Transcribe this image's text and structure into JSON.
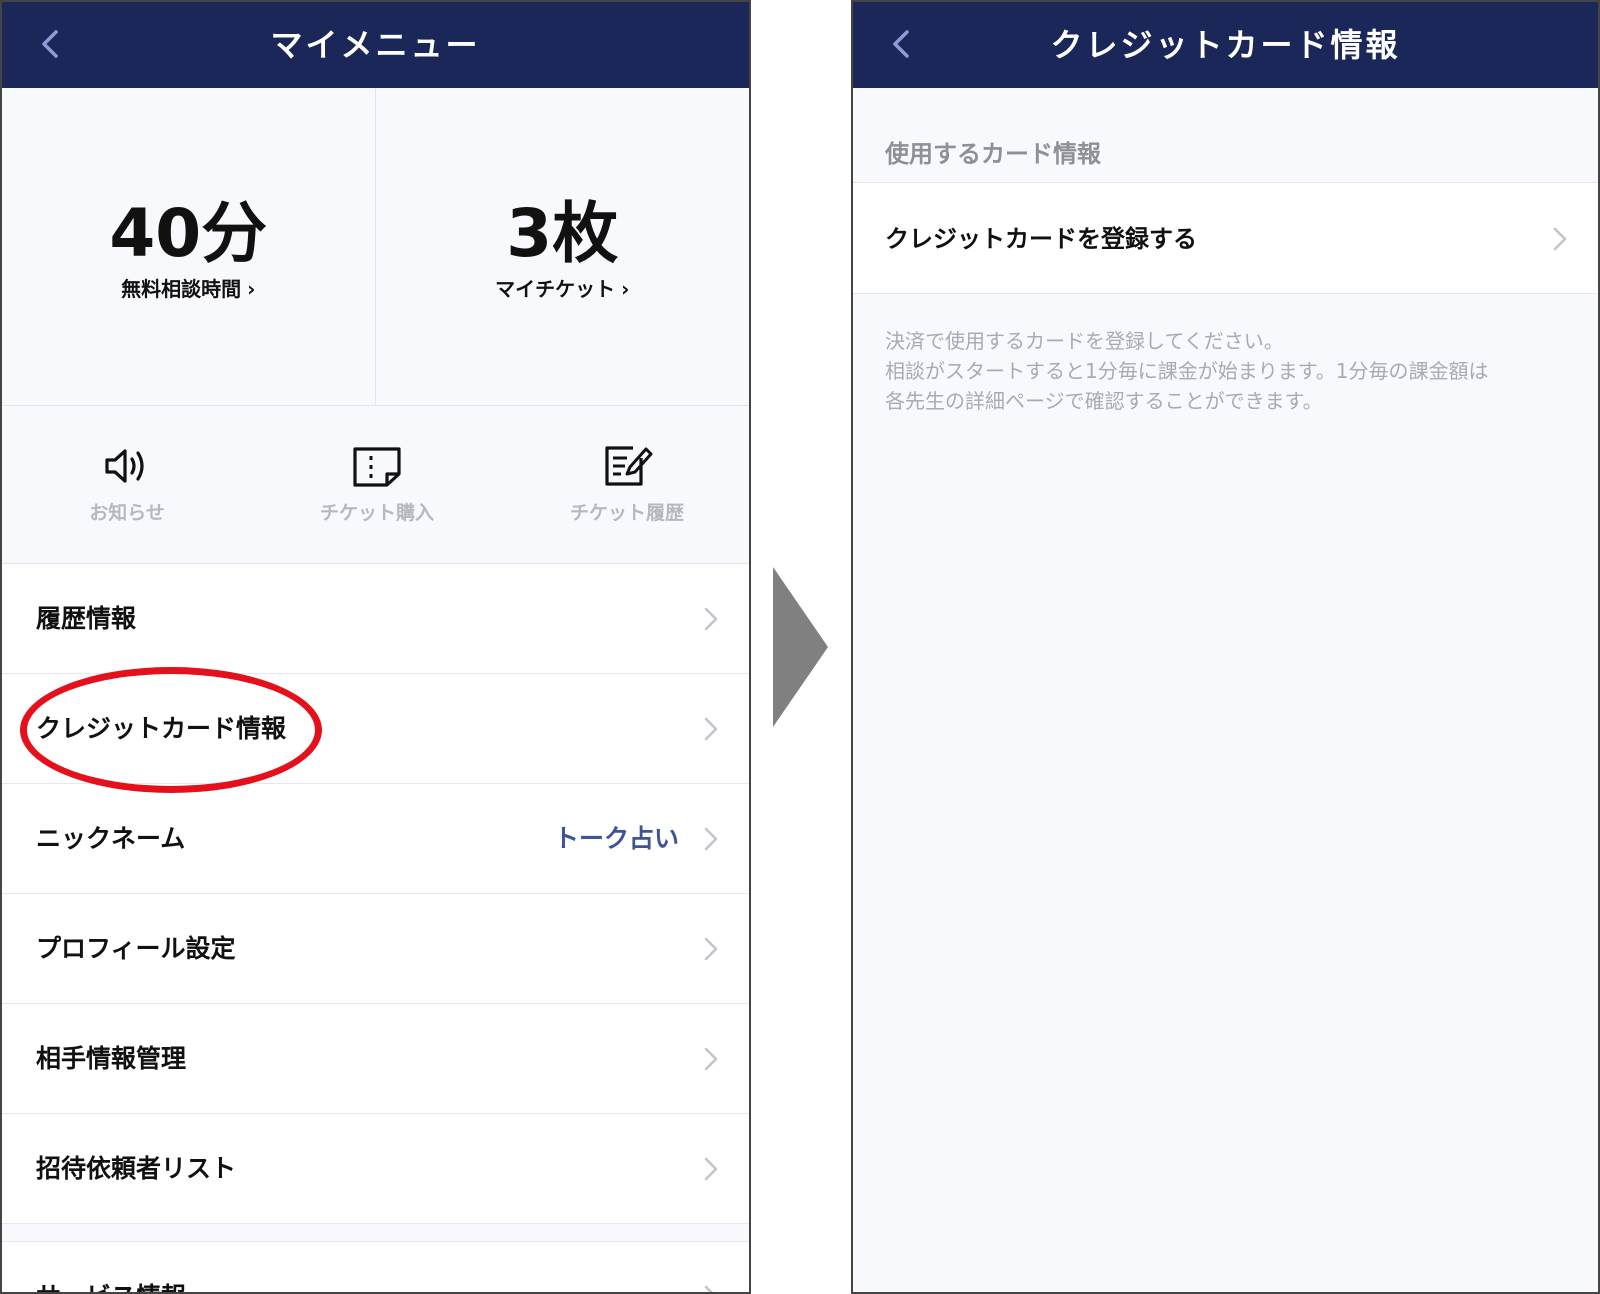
{
  "left_screen": {
    "header": {
      "title": "マイメニュー"
    },
    "stats": [
      {
        "value": "40分",
        "label": "無料相談時間",
        "chevron": "›"
      },
      {
        "value": "3枚",
        "label": "マイチケット",
        "chevron": "›"
      }
    ],
    "quick_actions": [
      {
        "icon": "speaker-icon",
        "label": "お知らせ"
      },
      {
        "icon": "ticket-icon",
        "label": "チケット購入"
      },
      {
        "icon": "edit-note-icon",
        "label": "チケット履歴"
      }
    ],
    "menu": [
      {
        "label": "履歴情報",
        "value": ""
      },
      {
        "label": "クレジットカード情報",
        "value": ""
      },
      {
        "label": "ニックネーム",
        "value": "トーク占い"
      },
      {
        "label": "プロフィール設定",
        "value": ""
      },
      {
        "label": "相手情報管理",
        "value": ""
      },
      {
        "label": "招待依頼者リスト",
        "value": ""
      }
    ],
    "next_section_label": "サービス情報"
  },
  "right_screen": {
    "header": {
      "title": "クレジットカード情報"
    },
    "section_heading": "使用するカード情報",
    "register_label": "クレジットカードを登録する",
    "note_lines": [
      "決済で使用するカードを登録してください。",
      "相談がスタートすると1分毎に課金が始まります。1分毎の課金額は",
      "各先生の詳細ページで確認することができます。"
    ]
  },
  "colors": {
    "header_bg": "#1b2659",
    "accent_blue": "#3f5398",
    "highlight_red": "#e4101c",
    "arrow_gray": "#808080"
  }
}
